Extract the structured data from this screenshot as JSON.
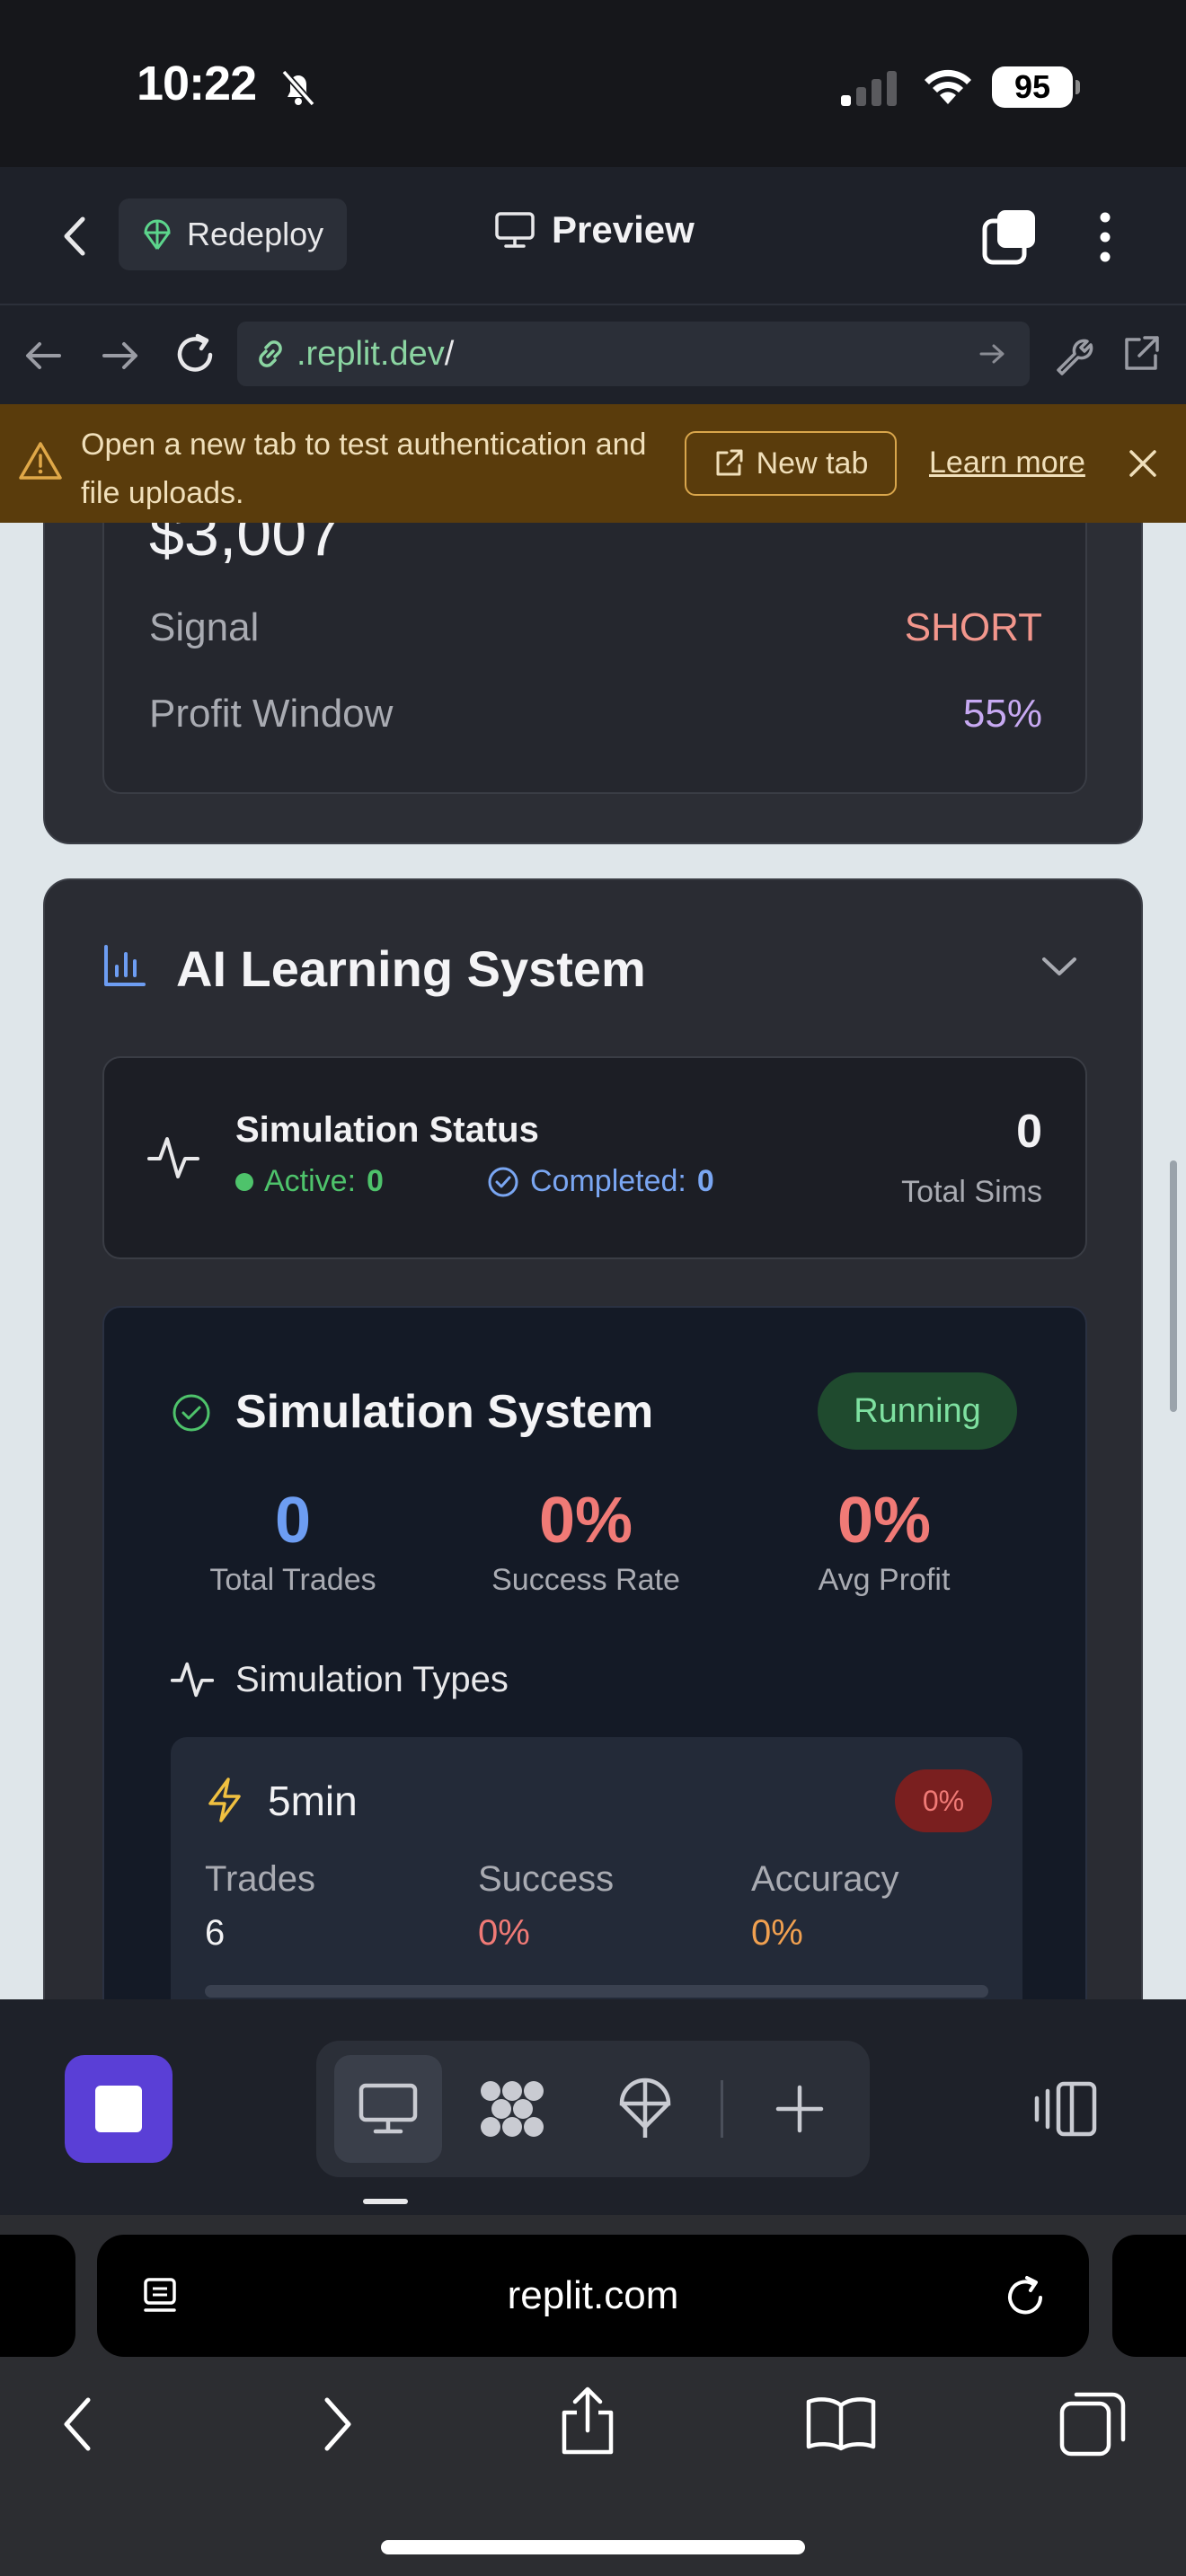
{
  "status_bar": {
    "time": "10:22",
    "battery": "95"
  },
  "header": {
    "redeploy_label": "Redeploy",
    "preview_label": "Preview"
  },
  "browser": {
    "url": ".replit.dev",
    "url_suffix": "/"
  },
  "banner": {
    "message": "Open a new tab to test authentication and file uploads.",
    "new_tab_label": "New tab",
    "learn_more_label": "Learn more"
  },
  "trade_card": {
    "price_partial": "$3,007",
    "signal_label": "Signal",
    "signal_value": "SHORT",
    "profit_label": "Profit Window",
    "profit_value": "55%"
  },
  "ai_section": {
    "title": "AI Learning System",
    "sim_status": {
      "title": "Simulation Status",
      "active_label": "Active:",
      "active_value": "0",
      "completed_label": "Completed:",
      "completed_value": "0",
      "total_value": "0",
      "total_label": "Total Sims"
    },
    "sim_system": {
      "title": "Simulation System",
      "status_badge": "Running",
      "total_trades_value": "0",
      "total_trades_label": "Total Trades",
      "success_rate_value": "0%",
      "success_rate_label": "Success Rate",
      "avg_profit_value": "0%",
      "avg_profit_label": "Avg Profit",
      "types_title": "Simulation Types",
      "type": {
        "name": "5min",
        "badge": "0%",
        "trades_label": "Trades",
        "trades_value": "6",
        "success_label": "Success",
        "success_value": "0%",
        "accuracy_label": "Accuracy",
        "accuracy_value": "0%"
      }
    }
  },
  "safari": {
    "domain": "replit.com"
  },
  "colors": {
    "short_red": "#f2968c",
    "profit_purple": "#c7a9f2",
    "active_green": "#4ec36b",
    "completed_blue": "#7aa6f2",
    "trades_blue": "#6d9df2",
    "rate_red": "#f07a76",
    "running_bg": "#1f4a2e",
    "running_text": "#7ee0a0",
    "accuracy_orange": "#f0a050",
    "badge_red": "#7a1f1f"
  }
}
